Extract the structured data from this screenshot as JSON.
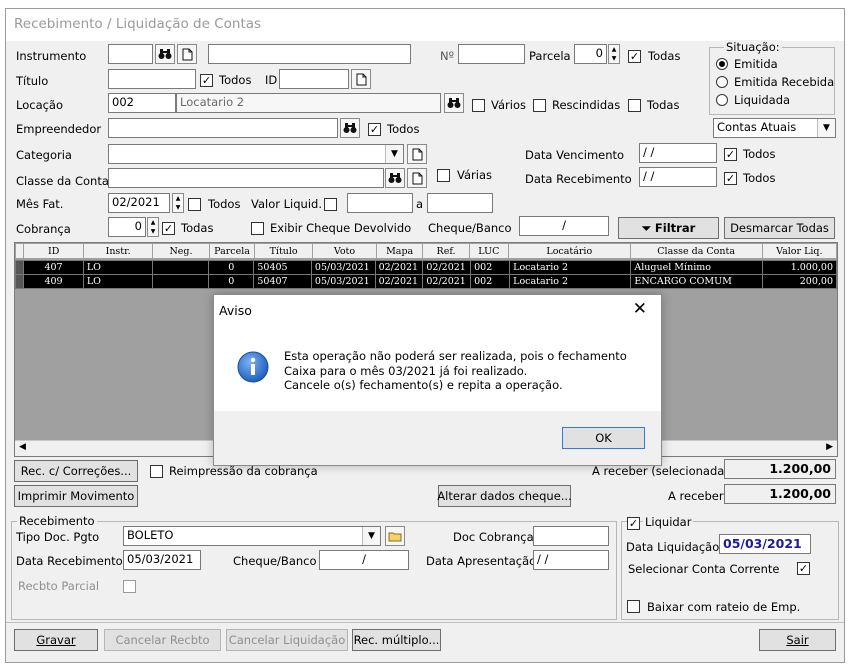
{
  "window": {
    "title": "Recebimento / Liquidação de Contas"
  },
  "form": {
    "instrumento_label": "Instrumento",
    "instrumento_code": "",
    "instrumento_desc": "",
    "n_label": "Nº",
    "n_value": "",
    "parcela_label": "Parcela",
    "parcela_value": "0",
    "parcela_todas": "Todas",
    "titulo_label": "Título",
    "titulo_value": "",
    "titulo_todos": "Todos",
    "id_label": "ID",
    "id_value": "",
    "locacao_label": "Locação",
    "locacao_code": "002",
    "locacao_desc": "Locatario 2",
    "varios": "Vários",
    "rescindidas": "Rescindidas",
    "locacao_todas": "Todas",
    "empreendedor_label": "Empreendedor",
    "empreendedor_value": "",
    "empreendedor_todos": "Todos",
    "categoria_label": "Categoria",
    "categoria_value": "",
    "classe_label": "Classe da Conta",
    "classe_value": "",
    "classe_varias": "Várias",
    "data_venc_label": "Data Vencimento",
    "data_venc_value": " / /",
    "data_venc_todos": "Todos",
    "data_rec_label": "Data Recebimento",
    "data_rec_value": " / /",
    "data_rec_todos": "Todos",
    "mes_fat_label": "Mês Fat.",
    "mes_fat_value": "02/2021",
    "mes_fat_todos": "Todos",
    "valor_liquid_label": "Valor Liquid.",
    "valor_from": "",
    "valor_a": "a",
    "valor_to": "",
    "cobranca_label": "Cobrança",
    "cobranca_value": "0",
    "cobranca_todas": "Todas",
    "exibir_cheque": "Exibir Cheque Devolvido",
    "cheque_banco_label": "Cheque/Banco",
    "cheque_banco_value": "/",
    "filtrar": "Filtrar",
    "desmarcar": "Desmarcar Todas"
  },
  "situacao": {
    "title": "Situação:",
    "options": [
      "Emitida",
      "Emitida Recebida",
      "Liquidada"
    ],
    "selected": "Emitida"
  },
  "contas": {
    "value": "Contas Atuais"
  },
  "grid": {
    "columns": [
      "ID",
      "Instr.",
      "Neg.",
      "Parcela",
      "Título",
      "Voto",
      "Mapa",
      "Ref.",
      "LUC",
      "Locatário",
      "Classe da Conta",
      "Valor Liq."
    ],
    "rows": [
      [
        "407",
        "LO",
        "",
        "0",
        "50405",
        "05/03/2021",
        "02/2021",
        "02/2021",
        "002",
        "Locatario 2",
        "Aluguel Mínimo",
        "1.000,00"
      ],
      [
        "409",
        "LO",
        "",
        "0",
        "50407",
        "05/03/2021",
        "02/2021",
        "02/2021",
        "002",
        "Locatario 2",
        "ENCARGO COMUM",
        "200,00"
      ]
    ]
  },
  "actions": {
    "rec_correcoes": "Rec. c/ Correções...",
    "reimpressao": "Reimpressão da cobrança",
    "imprimir": "Imprimir Movimento",
    "alterar_cheque": "Alterar dados cheque...",
    "a_receber_sel_label": "A receber (selecionada)",
    "a_receber_sel_value": "1.200,00",
    "a_receber_label": "A receber",
    "a_receber_value": "1.200,00"
  },
  "recebimento": {
    "title": "Recebimento",
    "tipo_label": "Tipo Doc. Pgto",
    "tipo_value": "BOLETO",
    "doc_cob_label": "Doc Cobrança",
    "doc_cob_value": "",
    "data_rec_label": "Data Recebimento",
    "data_rec_value": "05/03/2021",
    "cheque_banco_label": "Cheque/Banco",
    "cheque_banco_value": "/",
    "data_apres_label": "Data Apresentação",
    "data_apres_value": " / /",
    "rcbto_parcial": "Recbto Parcial"
  },
  "liquidar": {
    "title": "Liquidar",
    "data_label": "Data Liquidação",
    "data_value": "05/03/2021",
    "sel_conta": "Selecionar Conta Corrente",
    "baixar": "Baixar com rateio de Emp."
  },
  "footer": {
    "gravar": "Gravar",
    "cancelar_recbto": "Cancelar Recbto",
    "cancelar_liq": "Cancelar Liquidação",
    "rec_multiplo": "Rec. múltiplo...",
    "sair": "Sair"
  },
  "dialog": {
    "title": "Aviso",
    "line1": "Esta operação não poderá ser realizada, pois o fechamento",
    "line2": "Caixa para o mês 03/2021 já foi realizado.",
    "line3": "Cancele o(s) fechamento(s) e repita a operação.",
    "ok": "OK"
  },
  "colors": {
    "accent_blue": "#1a1aa6",
    "info_icon": "#2a6fd0"
  }
}
